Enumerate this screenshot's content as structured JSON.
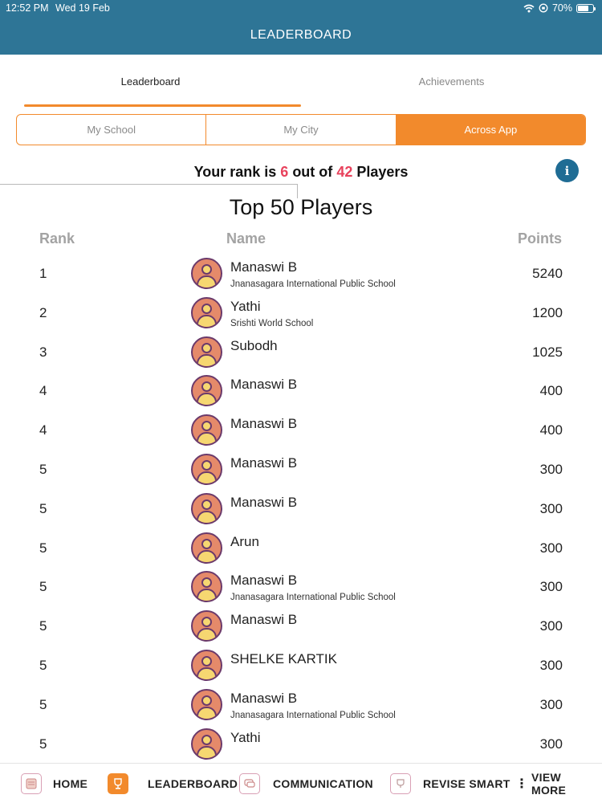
{
  "status_bar": {
    "time": "12:52 PM",
    "date": "Wed 19 Feb",
    "battery_text": "70%",
    "battery_level": 0.7,
    "wifi_icon": "wifi-icon",
    "lock_icon": "orientation-lock-icon"
  },
  "header": {
    "title": "LEADERBOARD"
  },
  "tabs": [
    {
      "label": "Leaderboard",
      "active": true
    },
    {
      "label": "Achievements",
      "active": false
    }
  ],
  "scope_filter": {
    "options": [
      "My School",
      "My City",
      "Across App"
    ],
    "selected": "Across App"
  },
  "rank_message": {
    "prefix": "Your rank is",
    "rank": "6",
    "middle": "out of",
    "total": "42",
    "suffix": "Players"
  },
  "info_button": {
    "icon": "info-icon",
    "glyph": "i"
  },
  "top_players": {
    "title": "Top 50 Players",
    "columns": {
      "rank": "Rank",
      "name": "Name",
      "points": "Points"
    },
    "rows": [
      {
        "rank": "1",
        "name": "Manaswi B",
        "school": "Jnanasagara International Public School",
        "points": "5240"
      },
      {
        "rank": "2",
        "name": "Yathi",
        "school": "Srishti World School",
        "points": "1200"
      },
      {
        "rank": "3",
        "name": "Subodh",
        "school": "",
        "points": "1025"
      },
      {
        "rank": "4",
        "name": "Manaswi B",
        "school": "",
        "points": "400"
      },
      {
        "rank": "4",
        "name": "Manaswi B",
        "school": "",
        "points": "400"
      },
      {
        "rank": "5",
        "name": "Manaswi B",
        "school": "",
        "points": "300"
      },
      {
        "rank": "5",
        "name": "Manaswi B",
        "school": "",
        "points": "300"
      },
      {
        "rank": "5",
        "name": "Arun",
        "school": "",
        "points": "300"
      },
      {
        "rank": "5",
        "name": "Manaswi B",
        "school": "Jnanasagara International Public School",
        "points": "300"
      },
      {
        "rank": "5",
        "name": "Manaswi B",
        "school": "",
        "points": "300"
      },
      {
        "rank": "5",
        "name": "SHELKE KARTIK",
        "school": "",
        "points": "300"
      },
      {
        "rank": "5",
        "name": "Manaswi B",
        "school": "Jnanasagara International Public School",
        "points": "300"
      },
      {
        "rank": "5",
        "name": "Yathi",
        "school": "",
        "points": "300"
      }
    ]
  },
  "bottom_nav": {
    "home": {
      "label": "HOME",
      "icon": "home-icon"
    },
    "leaderboard": {
      "label": "LEADERBOARD",
      "icon": "trophy-icon"
    },
    "communication": {
      "label": "COMMUNICATION",
      "icon": "chat-icon"
    },
    "revise": {
      "label": "REVISE SMART",
      "icon": "revise-icon"
    },
    "more": {
      "label": "VIEW MORE",
      "icon": "more-vertical-icon"
    }
  },
  "colors": {
    "header_bg": "#2e7596",
    "accent": "#f28a2c",
    "highlight": "#e8425c",
    "info_bg": "#1f6c94"
  }
}
